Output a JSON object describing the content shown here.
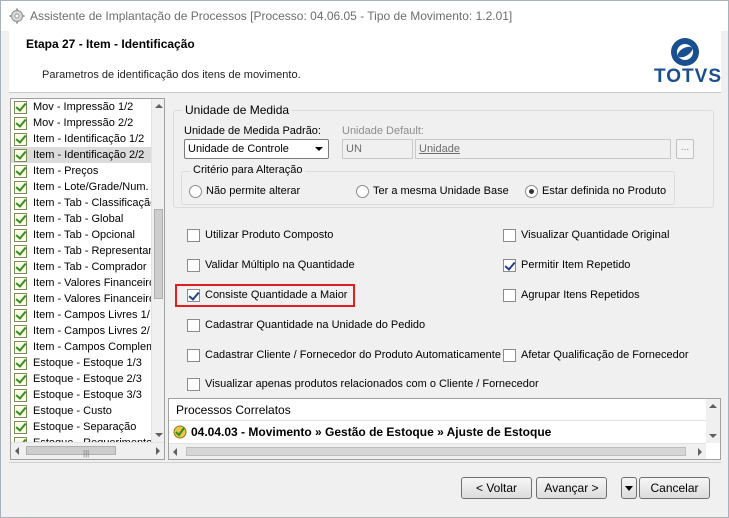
{
  "window": {
    "title": "Assistente de Implantação de Processos [Processo: 04.06.05 - Tipo de Movimento: 1.2.01]"
  },
  "header": {
    "step_title": "Etapa 27 - Item - Identificação",
    "step_description": "Parametros de identificação dos itens de movimento.",
    "logo_text": "TOTVS",
    "logo_color": "#1a4f8f"
  },
  "steps": {
    "items": [
      {
        "label": "Mov - Impressão 1/2",
        "selected": false
      },
      {
        "label": "Mov - Impressão 2/2",
        "selected": false
      },
      {
        "label": "Item - Identificação 1/2",
        "selected": false
      },
      {
        "label": "Item - Identificação 2/2",
        "selected": true
      },
      {
        "label": "Item - Preços",
        "selected": false
      },
      {
        "label": "Item - Lote/Grade/Num.",
        "selected": false
      },
      {
        "label": "Item - Tab - Classificação",
        "selected": false
      },
      {
        "label": "Item - Tab - Global",
        "selected": false
      },
      {
        "label": "Item - Tab - Opcional",
        "selected": false
      },
      {
        "label": "Item - Tab - Representante",
        "selected": false
      },
      {
        "label": "Item - Tab - Comprador",
        "selected": false
      },
      {
        "label": "Item - Valores Financeiros",
        "selected": false
      },
      {
        "label": "Item - Valores Financeiros",
        "selected": false
      },
      {
        "label": "Item - Campos Livres 1/",
        "selected": false
      },
      {
        "label": "Item - Campos Livres 2/",
        "selected": false
      },
      {
        "label": "Item - Campos Complem",
        "selected": false
      },
      {
        "label": "Estoque - Estoque 1/3",
        "selected": false
      },
      {
        "label": "Estoque - Estoque 2/3",
        "selected": false
      },
      {
        "label": "Estoque - Estoque 3/3",
        "selected": false
      },
      {
        "label": "Estoque - Custo",
        "selected": false
      },
      {
        "label": "Estoque - Separação",
        "selected": false
      },
      {
        "label": "Estoque - Requerimento",
        "selected": false
      }
    ],
    "icon": "green-check-icon"
  },
  "unidade": {
    "group_label": "Unidade de Medida",
    "padrao_label": "Unidade de Medida Padrão:",
    "padrao_value": "Unidade de Controle",
    "default_label": "Unidade Default:",
    "default_code": "UN",
    "default_name": "Unidade",
    "lookup_label": "...",
    "criterio_label": "Critério para Alteração",
    "options": [
      {
        "label": "Não permite alterar",
        "selected": false
      },
      {
        "label": "Ter a mesma Unidade Base",
        "selected": false
      },
      {
        "label": "Estar definida no Produto",
        "selected": true
      }
    ]
  },
  "options": {
    "utilizar_produto_composto": {
      "label": "Utilizar Produto Composto",
      "checked": false
    },
    "visualizar_qtd_original": {
      "label": "Visualizar Quantidade Original",
      "checked": false
    },
    "validar_multiplo": {
      "label": "Validar Múltiplo na Quantidade",
      "checked": false
    },
    "permitir_item_repetido": {
      "label": "Permitir Item Repetido",
      "checked": true
    },
    "consiste_qtd_maior": {
      "label": "Consiste Quantidade a Maior",
      "checked": true
    },
    "agrupar_itens_repetidos": {
      "label": "Agrupar Itens Repetidos",
      "checked": false
    },
    "cadastrar_qtd_unidade_pedido": {
      "label": "Cadastrar Quantidade na Unidade do Pedido",
      "checked": false
    },
    "cadastrar_cliente_fornecedor": {
      "label": "Cadastrar Cliente / Fornecedor do Produto Automaticamente",
      "checked": false
    },
    "afetar_qualificacao_fornecedor": {
      "label": "Afetar Qualificação de Fornecedor",
      "checked": false
    },
    "visualizar_produtos_relacionados": {
      "label": "Visualizar apenas produtos relacionados com o Cliente / Fornecedor",
      "checked": false
    }
  },
  "related": {
    "title": "Processos Correlatos",
    "row": "04.04.03 - Movimento » Gestão de Estoque » Ajuste de Estoque"
  },
  "buttons": {
    "back": "< Voltar",
    "next": "Avançar >",
    "cancel": "Cancelar"
  }
}
